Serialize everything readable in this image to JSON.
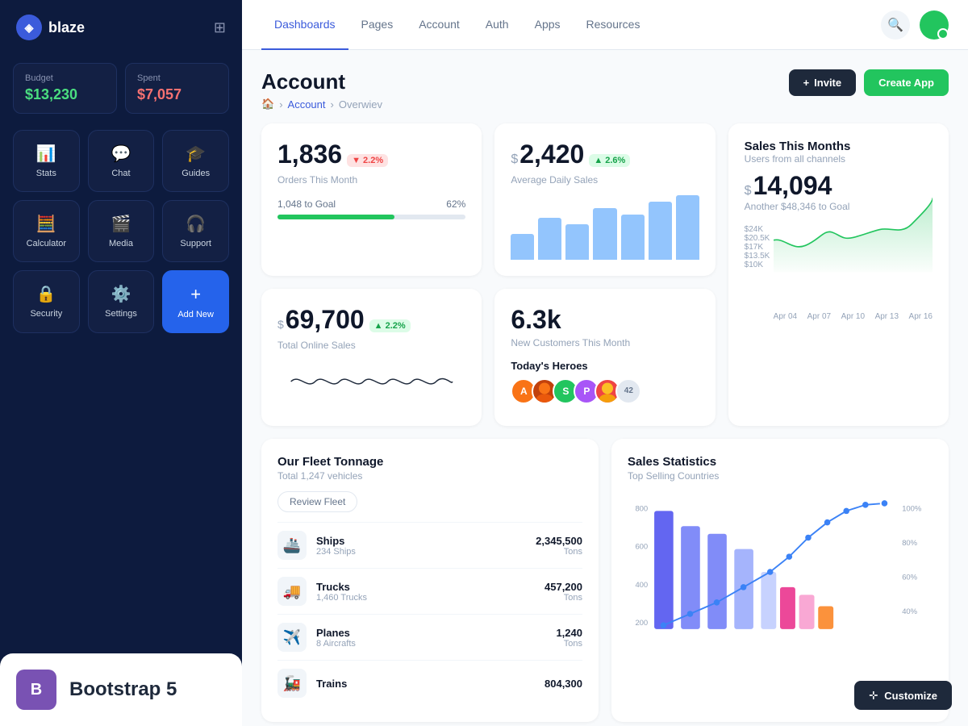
{
  "app": {
    "name": "blaze"
  },
  "sidebar": {
    "budget_label": "Budget",
    "budget_value": "$13,230",
    "spent_label": "Spent",
    "spent_value": "$7,057",
    "nav_items": [
      {
        "id": "stats",
        "label": "Stats",
        "icon": "📊"
      },
      {
        "id": "chat",
        "label": "Chat",
        "icon": "💬"
      },
      {
        "id": "guides",
        "label": "Guides",
        "icon": "🎓"
      },
      {
        "id": "calculator",
        "label": "Calculator",
        "icon": "🧮"
      },
      {
        "id": "media",
        "label": "Media",
        "icon": "🎬"
      },
      {
        "id": "support",
        "label": "Support",
        "icon": "🎧"
      },
      {
        "id": "security",
        "label": "Security",
        "icon": "🔒"
      },
      {
        "id": "settings",
        "label": "Settings",
        "icon": "⚙️"
      },
      {
        "id": "add-new",
        "label": "Add New",
        "icon": "+"
      }
    ],
    "bootstrap_label": "Bootstrap 5"
  },
  "topnav": {
    "items": [
      {
        "id": "dashboards",
        "label": "Dashboards",
        "active": true
      },
      {
        "id": "pages",
        "label": "Pages"
      },
      {
        "id": "account",
        "label": "Account"
      },
      {
        "id": "auth",
        "label": "Auth"
      },
      {
        "id": "apps",
        "label": "Apps"
      },
      {
        "id": "resources",
        "label": "Resources"
      }
    ]
  },
  "page": {
    "title": "Account",
    "breadcrumb": {
      "home": "🏠",
      "account": "Account",
      "current": "Overwiev"
    },
    "invite_label": "Invite",
    "create_label": "Create App"
  },
  "stats": {
    "orders": {
      "value": "1,836",
      "badge": "▼ 2.2%",
      "badge_type": "red",
      "label": "Orders This Month",
      "goal_text": "1,048 to Goal",
      "goal_pct": "62%",
      "goal_fill": 62
    },
    "daily_sales": {
      "prefix": "$",
      "value": "2,420",
      "badge": "▲ 2.6%",
      "badge_type": "green",
      "label": "Average Daily Sales"
    },
    "sales_month": {
      "title": "Sales This Months",
      "sub": "Users from all channels",
      "prefix": "$",
      "value": "14,094",
      "sub2": "Another $48,346 to Goal",
      "y_labels": [
        "$24K",
        "$20.5K",
        "$17K",
        "$13.5K",
        "$10K"
      ],
      "x_labels": [
        "Apr 04",
        "Apr 07",
        "Apr 10",
        "Apr 13",
        "Apr 16"
      ]
    },
    "online_sales": {
      "prefix": "$",
      "value": "69,700",
      "badge": "▲ 2.2%",
      "badge_type": "green",
      "label": "Total Online Sales"
    },
    "customers": {
      "value": "6.3k",
      "label": "New Customers This Month"
    },
    "heroes": {
      "title": "Today's Heroes",
      "count_label": "42"
    }
  },
  "fleet": {
    "title": "Our Fleet Tonnage",
    "subtitle": "Total 1,247 vehicles",
    "review_btn": "Review Fleet",
    "items": [
      {
        "name": "Ships",
        "sub": "234 Ships",
        "value": "2,345,500",
        "unit": "Tons",
        "icon": "🚢"
      },
      {
        "name": "Trucks",
        "sub": "1,460 Trucks",
        "value": "457,200",
        "unit": "Tons",
        "icon": "🚚"
      },
      {
        "name": "Planes",
        "sub": "8 Aircrafts",
        "value": "1,240",
        "unit": "Tons",
        "icon": "✈️"
      },
      {
        "name": "Trains",
        "sub": "",
        "value": "804,300",
        "unit": "",
        "icon": "🚂"
      }
    ]
  },
  "sales_stats": {
    "title": "Sales Statistics",
    "subtitle": "Top Selling Countries",
    "y_labels": [
      "800",
      "600",
      "400",
      "200"
    ],
    "pct_labels": [
      "100%",
      "80%",
      "60%",
      "40%"
    ]
  },
  "customize": {
    "label": "Customize"
  }
}
